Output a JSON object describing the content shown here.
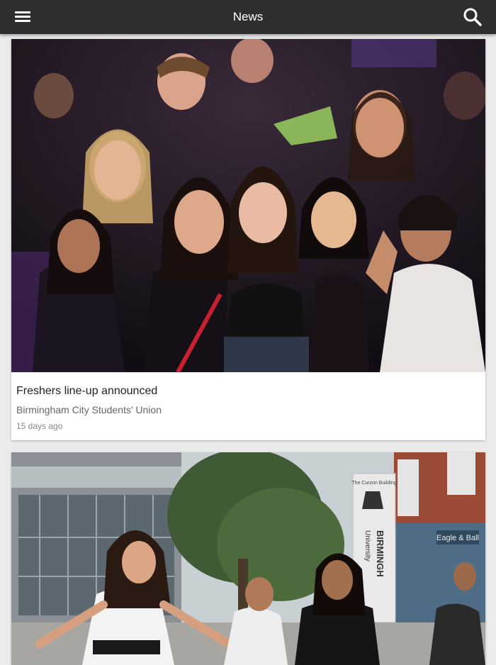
{
  "appbar": {
    "title": "News",
    "menu_icon": "hamburger-menu-icon",
    "search_icon": "search-icon",
    "background": "#2e2e2e"
  },
  "articles": [
    {
      "headline": "Freshers line-up announced",
      "source": "Birmingham City Students' Union",
      "age": "15 days ago"
    },
    {
      "image_text": {
        "sign_top": "The Curzon Building",
        "sign_main": "BIRMINGH",
        "sign_sub": "University",
        "shop_sign": "Eagle & Ball"
      }
    }
  ]
}
